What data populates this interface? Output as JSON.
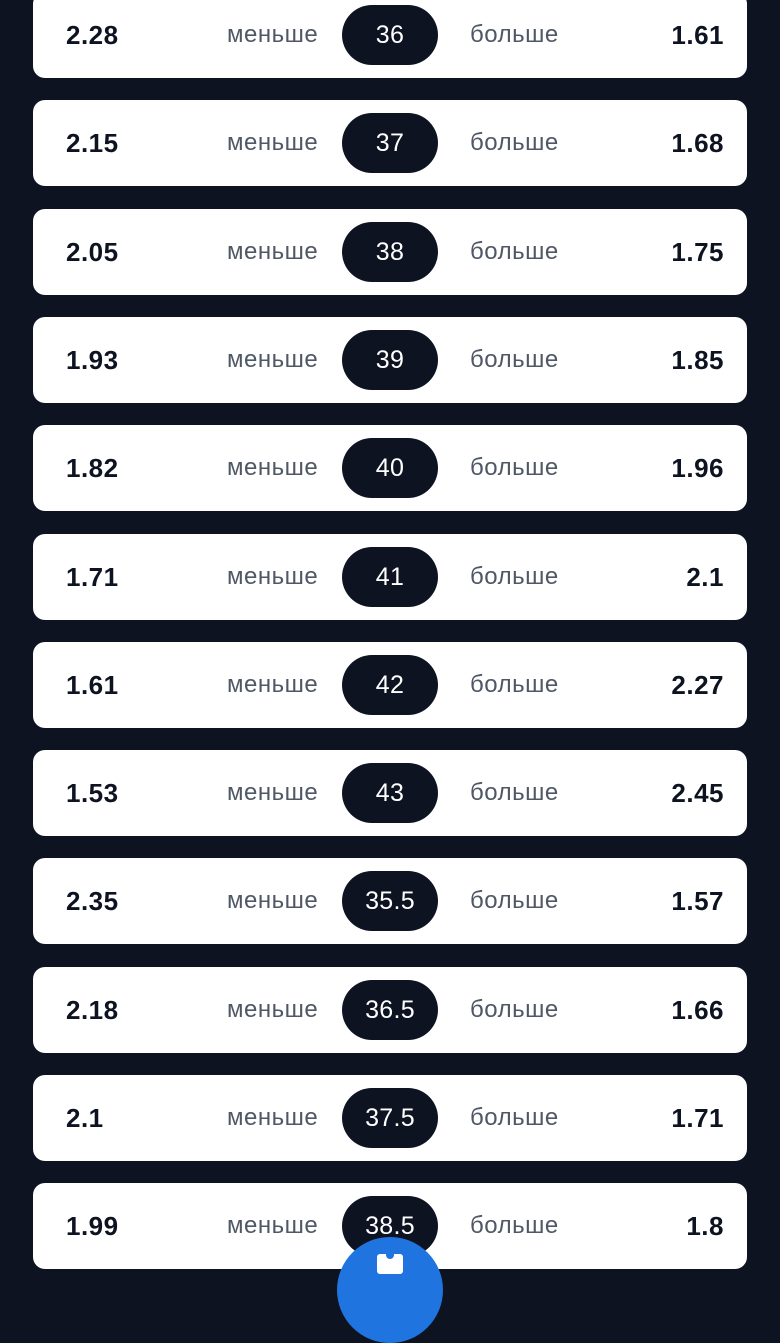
{
  "labels": {
    "under": "меньше",
    "over": "больше"
  },
  "rows": [
    {
      "under_odds": "2.28",
      "total": "36",
      "over_odds": "1.61"
    },
    {
      "under_odds": "2.15",
      "total": "37",
      "over_odds": "1.68"
    },
    {
      "under_odds": "2.05",
      "total": "38",
      "over_odds": "1.75"
    },
    {
      "under_odds": "1.93",
      "total": "39",
      "over_odds": "1.85"
    },
    {
      "under_odds": "1.82",
      "total": "40",
      "over_odds": "1.96"
    },
    {
      "under_odds": "1.71",
      "total": "41",
      "over_odds": "2.1"
    },
    {
      "under_odds": "1.61",
      "total": "42",
      "over_odds": "2.27"
    },
    {
      "under_odds": "1.53",
      "total": "43",
      "over_odds": "2.45"
    },
    {
      "under_odds": "2.35",
      "total": "35.5",
      "over_odds": "1.57"
    },
    {
      "under_odds": "2.18",
      "total": "36.5",
      "over_odds": "1.66"
    },
    {
      "under_odds": "2.1",
      "total": "37.5",
      "over_odds": "1.71"
    },
    {
      "under_odds": "1.99",
      "total": "38.5",
      "over_odds": "1.8"
    }
  ],
  "fab": {
    "icon": "bet-slip-icon"
  },
  "colors": {
    "background": "#0d1321",
    "card": "#ffffff",
    "pill": "#0d1321",
    "accent": "#1f74e0"
  }
}
